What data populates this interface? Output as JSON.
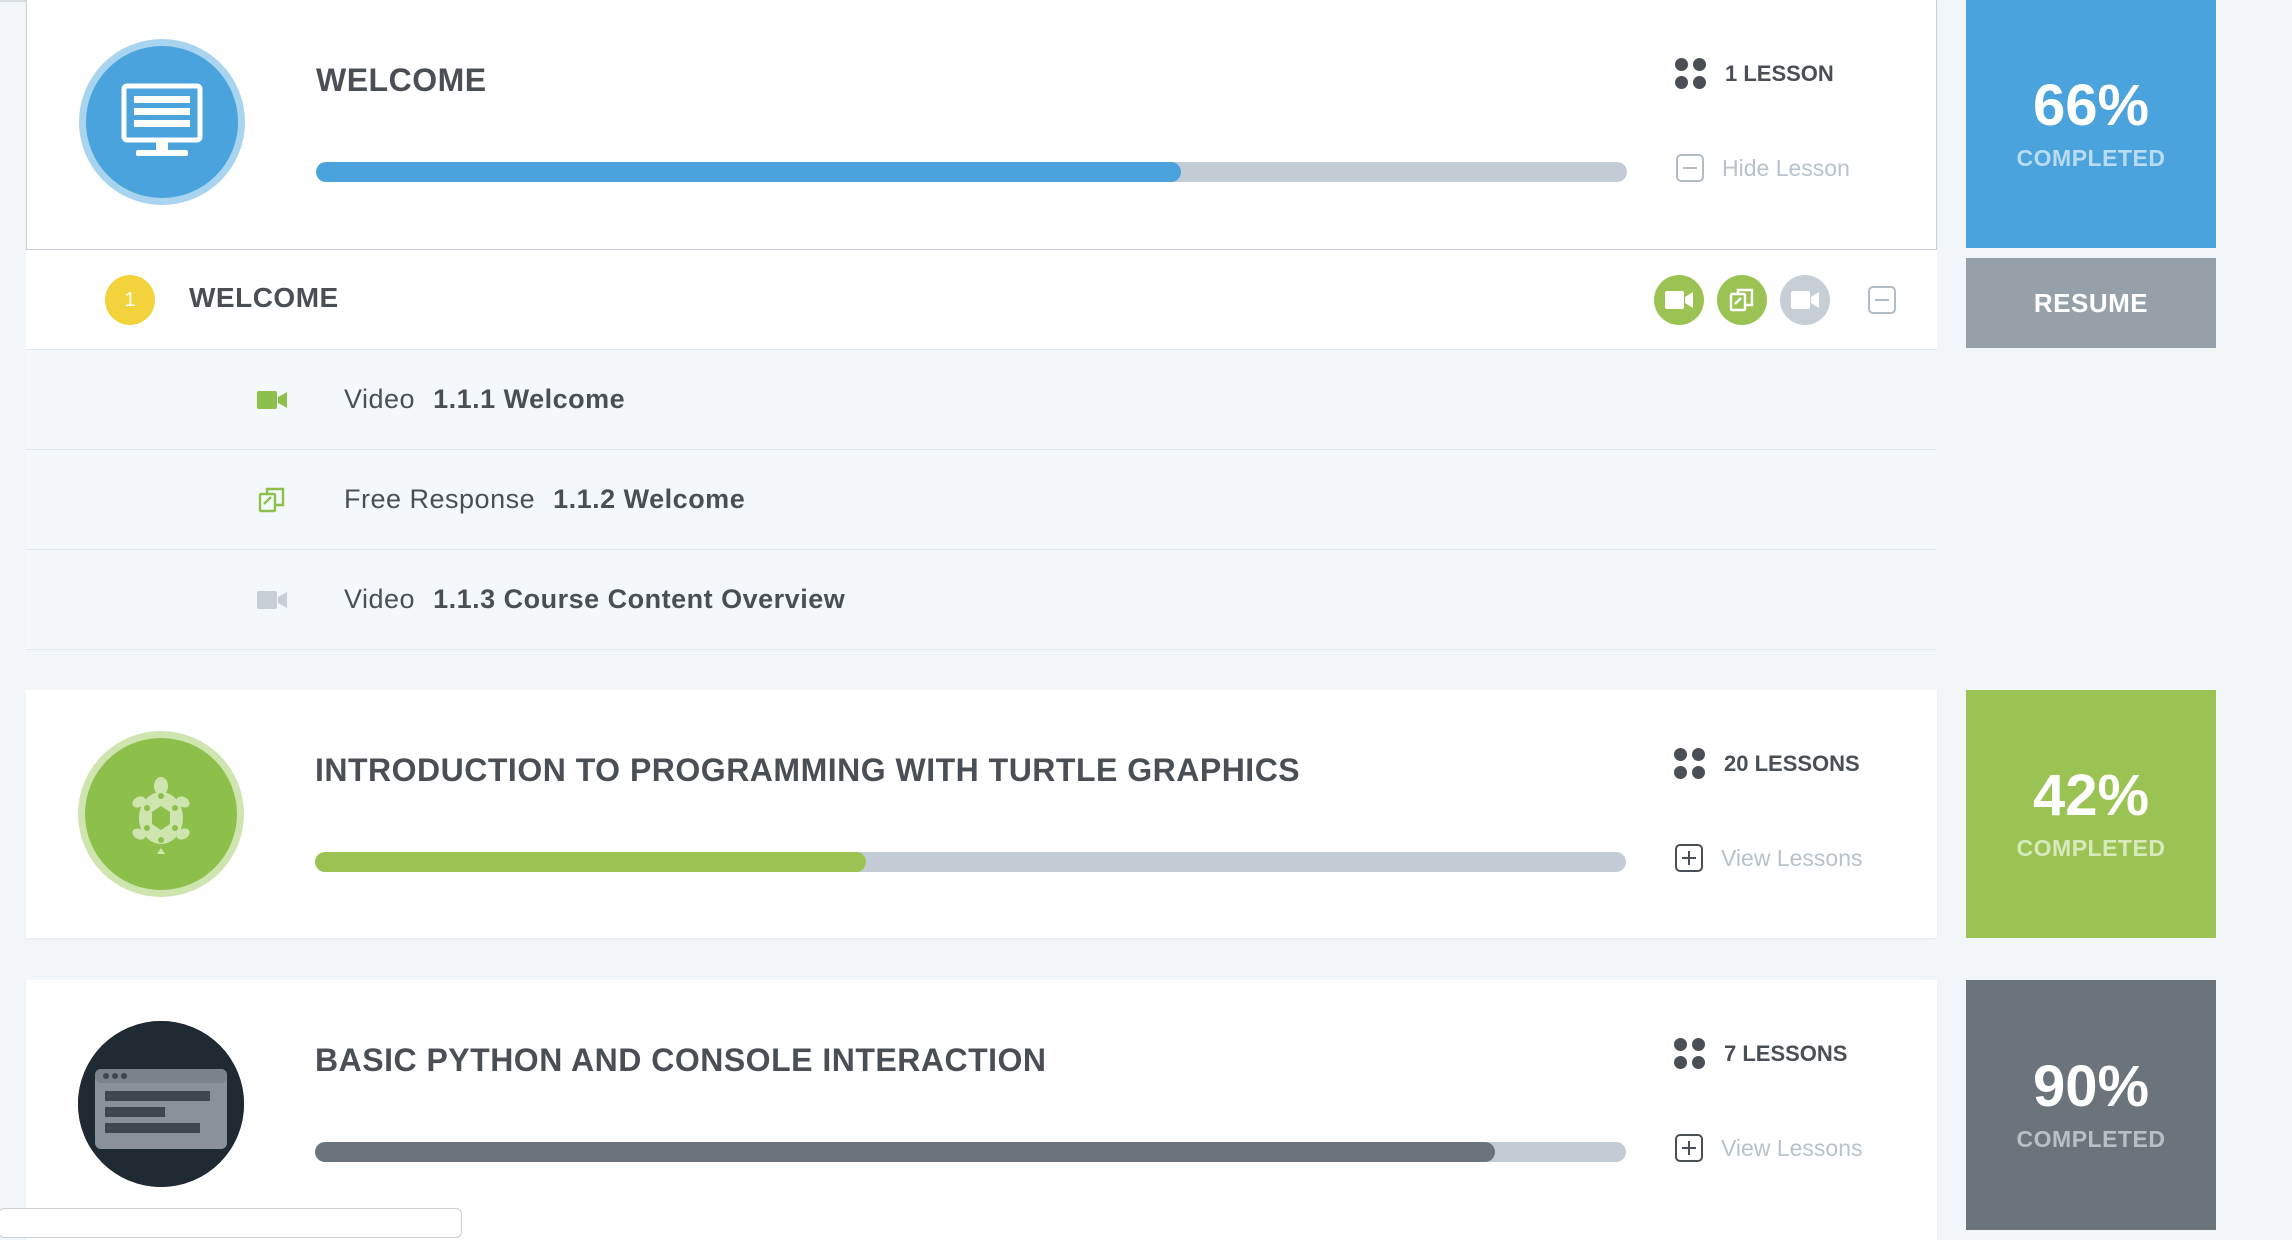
{
  "colors": {
    "blue": "#4aa3dc",
    "green": "#9bc354",
    "gray": "#6c747b",
    "track": "#c3ccd4",
    "yellow": "#f3d33c"
  },
  "units": [
    {
      "title": "WELCOME",
      "icon": "monitor-icon",
      "progress": 0.66,
      "lesson_count": "1 LESSON",
      "toggle_label": "Hide Lesson",
      "percent": "66%",
      "completed_label": "COMPLETED"
    },
    {
      "title": "INTRODUCTION TO PROGRAMMING WITH TURTLE GRAPHICS",
      "icon": "turtle-icon",
      "progress": 0.42,
      "lesson_count": "20 LESSONS",
      "toggle_label": "View Lessons",
      "percent": "42%",
      "completed_label": "COMPLETED"
    },
    {
      "title": "BASIC PYTHON AND CONSOLE INTERACTION",
      "icon": "console-window-icon",
      "progress": 0.9,
      "lesson_count": "7 LESSONS",
      "toggle_label": "View Lessons",
      "percent": "90%",
      "completed_label": "COMPLETED"
    }
  ],
  "resume_label": "RESUME",
  "lesson": {
    "number": "1",
    "title": "WELCOME",
    "status_icons": [
      "video-icon",
      "free-response-icon",
      "video-icon"
    ]
  },
  "activities": [
    {
      "type": "Video",
      "name": "1.1.1 Welcome",
      "icon": "video-icon",
      "done": true
    },
    {
      "type": "Free Response",
      "name": "1.1.2 Welcome",
      "icon": "free-response-icon",
      "done": true
    },
    {
      "type": "Video",
      "name": "1.1.3 Course Content Overview",
      "icon": "video-icon",
      "done": false
    }
  ]
}
